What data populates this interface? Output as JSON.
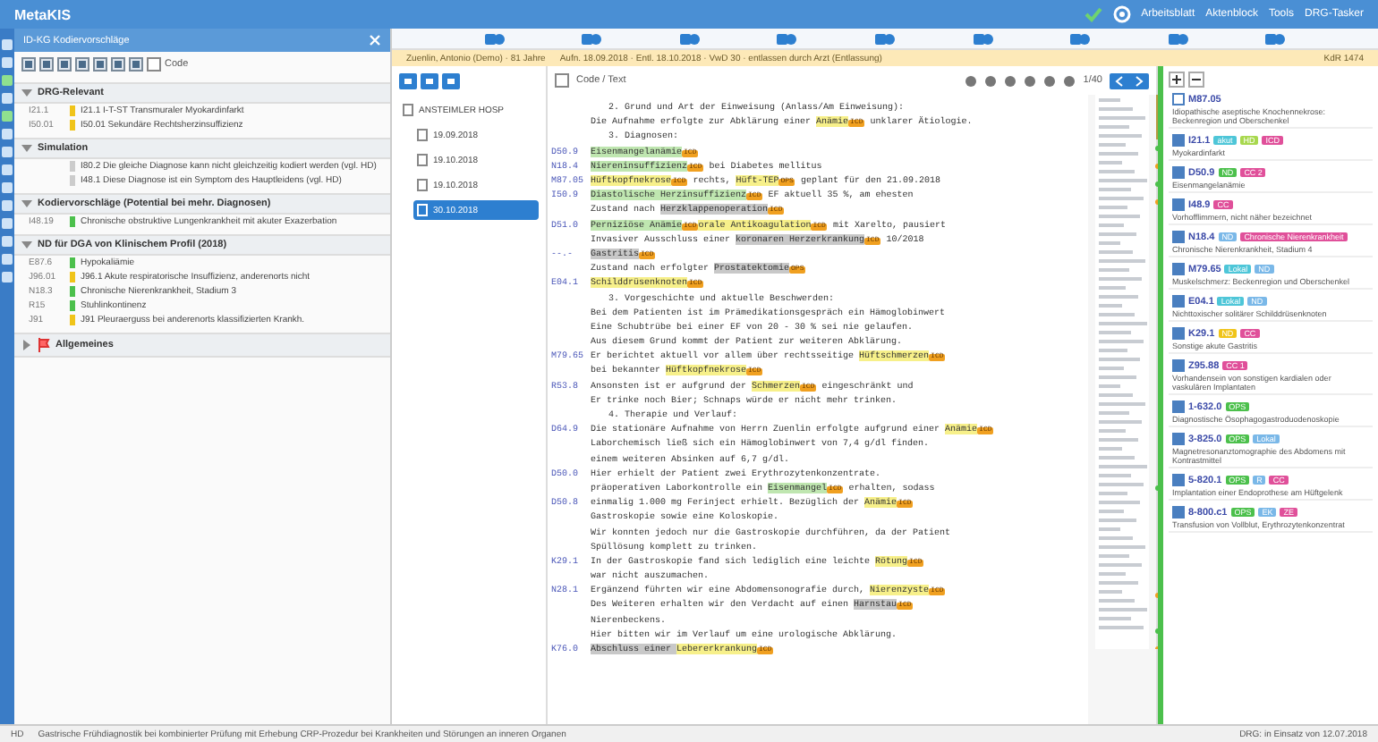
{
  "app": {
    "title": "MetaKIS",
    "menu": [
      "Arbeitsblatt",
      "Aktenblock",
      "Tools",
      "DRG-Tasker"
    ]
  },
  "left_panel": {
    "title": "ID-KG Kodiervorschläge",
    "filter": {
      "label": "Code",
      "checked": false
    },
    "groups": [
      {
        "title": "DRG-Relevant",
        "expanded": true,
        "items": [
          {
            "code": "I21.1",
            "text": "I21.1 I-T-ST Transmuraler Myokardinfarkt",
            "color": "#f0c419"
          },
          {
            "code": "I50.01",
            "text": "I50.01 Sekundäre Rechtsherzinsuffizienz",
            "color": "#f0c419"
          }
        ]
      },
      {
        "title": "Simulation",
        "expanded": true,
        "items": [
          {
            "text": "I80.2 Die gleiche Diagnose kann nicht gleichzeitig kodiert werden (vgl. HD)",
            "color": "#cccccc"
          },
          {
            "text": "I48.1 Diese Diagnose ist ein Symptom des Hauptleidens (vgl. HD)",
            "color": "#cccccc"
          }
        ]
      },
      {
        "title": "Kodiervorschläge (Potential bei mehr. Diagnosen)",
        "expanded": true,
        "items": [
          {
            "code": "I48.19",
            "text": "Chronische obstruktive Lungenkrankheit mit akuter Exazerbation",
            "color": "#4cc04c"
          }
        ]
      },
      {
        "title": "ND für DGA von Klinischem Profil (2018)",
        "expanded": true,
        "items": [
          {
            "code": "E87.6",
            "text": "Hypokaliämie",
            "color": "#4cc04c"
          },
          {
            "code": "J96.01",
            "text": "J96.1 Akute respiratorische Insuffizienz, anderenorts nicht",
            "color": "#f0c419"
          },
          {
            "code": "N18.3",
            "text": "Chronische Nierenkrankheit, Stadium 3",
            "color": "#4cc04c"
          },
          {
            "code": "R15",
            "text": "Stuhlinkontinenz",
            "color": "#4cc04c"
          },
          {
            "code": "J91",
            "text": "J91 Pleuraerguss bei anderenorts klassifizierten Krankh.",
            "color": "#f0c419"
          }
        ]
      },
      {
        "title": "Allgemeines",
        "expanded": false
      }
    ]
  },
  "patient_bar": {
    "patient": "Zuenlin, Antonio (Demo) · 81 Jahre",
    "case": "Aufn. 18.09.2018 · Entl. 18.10.2018 · VwD 30 · entlassen durch Arzt (Entlassung)",
    "right": "KdR 1474"
  },
  "tree": {
    "items": [
      {
        "label": "ANSTEIMLER HOSP",
        "selected": false,
        "children": [
          {
            "label": "19.09.2018",
            "selected": false
          },
          {
            "label": "19.10.2018",
            "selected": false
          },
          {
            "label": "19.10.2018",
            "selected": false
          },
          {
            "label": "30.10.2018",
            "selected": true
          }
        ]
      }
    ]
  },
  "editor": {
    "filter": {
      "label": "Code / Text",
      "checked": false
    },
    "page": "1/40",
    "lines": [
      {
        "kind": "section",
        "segments": [
          {
            "kind": "plain",
            "text": "2. Grund und Art der Einweisung (Anlass/Am Einweisung):"
          }
        ]
      },
      {
        "kind": "text",
        "segments": [
          {
            "kind": "plain",
            "text": "Die Aufnahme erfolgte zur Abklärung einer "
          },
          {
            "kind": "term",
            "text": "Anämie"
          },
          {
            "kind": "tag",
            "text": "ICD"
          },
          {
            "kind": "plain",
            "text": " unklarer Ätiologie."
          }
        ]
      },
      {
        "kind": "section",
        "segments": [
          {
            "kind": "plain",
            "text": "3. Diagnosen:"
          }
        ]
      },
      {
        "code": "D50.9",
        "kind": "text",
        "segments": [
          {
            "kind": "green",
            "text": "Eisenmangelanämie"
          },
          {
            "kind": "tag",
            "text": "ICD"
          }
        ]
      },
      {
        "code": "N18.4",
        "kind": "text",
        "segments": [
          {
            "kind": "green",
            "text": "Niereninsuffizienz"
          },
          {
            "kind": "tag",
            "text": "ICD"
          },
          {
            "kind": "plain",
            "text": " bei Diabetes mellitus"
          }
        ]
      },
      {
        "code": "M87.05",
        "kind": "text",
        "segments": [
          {
            "kind": "term",
            "text": "Hüftkopfnekrose"
          },
          {
            "kind": "tag",
            "text": "ICD"
          },
          {
            "kind": "plain",
            "text": " rechts, "
          },
          {
            "kind": "term",
            "text": "Hüft-TEP"
          },
          {
            "kind": "tag",
            "text": "OPS"
          },
          {
            "kind": "plain",
            "text": " geplant für den 21.09.2018"
          }
        ]
      },
      {
        "code": "I50.9",
        "kind": "text",
        "segments": [
          {
            "kind": "green",
            "text": "Diastolische Herzinsuffizienz"
          },
          {
            "kind": "tag",
            "text": "ICD"
          },
          {
            "kind": "plain",
            "text": " EF aktuell 35 %, am ehesten"
          }
        ]
      },
      {
        "kind": "text",
        "segments": [
          {
            "kind": "plain",
            "text": "Zustand nach "
          },
          {
            "kind": "grey",
            "text": "Herzklappenoperation"
          },
          {
            "kind": "tag",
            "text": "ICD"
          }
        ]
      },
      {
        "code": "D51.0",
        "kind": "text",
        "segments": [
          {
            "kind": "green",
            "text": "Perniziöse Anämie"
          },
          {
            "kind": "tag",
            "text": "ICD"
          },
          {
            "kind": "term",
            "text": "orale Antikoagulation"
          },
          {
            "kind": "tag",
            "text": "ICD"
          },
          {
            "kind": "plain",
            "text": " mit Xarelto, pausiert"
          }
        ]
      },
      {
        "kind": "text",
        "segments": [
          {
            "kind": "plain",
            "text": "Invasiver Ausschluss einer "
          },
          {
            "kind": "grey",
            "text": "koronaren Herzerkrankung"
          },
          {
            "kind": "tag",
            "text": "ICD"
          },
          {
            "kind": "plain",
            "text": " 10/2018"
          }
        ]
      },
      {
        "code": "--.-",
        "kind": "text",
        "segments": [
          {
            "kind": "grey",
            "text": "Gastritis"
          },
          {
            "kind": "tag",
            "text": "ICD"
          }
        ]
      },
      {
        "kind": "text",
        "segments": [
          {
            "kind": "plain",
            "text": "Zustand nach erfolgter "
          },
          {
            "kind": "grey",
            "text": "Prostatektomie"
          },
          {
            "kind": "tag",
            "text": "OPS"
          }
        ]
      },
      {
        "code": "E04.1",
        "kind": "text",
        "segments": [
          {
            "kind": "term",
            "text": "Schilddrüsenknoten"
          },
          {
            "kind": "tag",
            "text": "ICD"
          }
        ]
      },
      {
        "kind": "section",
        "segments": [
          {
            "kind": "plain",
            "text": "3. Vorgeschichte und aktuelle Beschwerden:"
          }
        ]
      },
      {
        "kind": "text",
        "segments": [
          {
            "kind": "plain",
            "text": "Bei dem Patienten ist im Prämedikationsgespräch ein Hämoglobinwert"
          }
        ]
      },
      {
        "kind": "text",
        "segments": [
          {
            "kind": "plain",
            "text": "Eine Schubtrübe bei einer EF von 20 - 30 % sei nie gelaufen."
          }
        ]
      },
      {
        "kind": "text",
        "segments": [
          {
            "kind": "plain",
            "text": "Aus diesem Grund kommt der Patient zur weiteren Abklärung."
          }
        ]
      },
      {
        "code": "M79.65",
        "kind": "text",
        "segments": [
          {
            "kind": "plain",
            "text": "Er berichtet aktuell vor allem über rechtsseitige "
          },
          {
            "kind": "term",
            "text": "Hüftschmerzen"
          },
          {
            "kind": "tag",
            "text": "ICD"
          }
        ]
      },
      {
        "kind": "text",
        "segments": [
          {
            "kind": "plain",
            "text": "bei bekannter "
          },
          {
            "kind": "term",
            "text": "Hüftkopfnekrose"
          },
          {
            "kind": "tag",
            "text": "ICD"
          }
        ]
      },
      {
        "code": "R53.8",
        "kind": "text",
        "segments": [
          {
            "kind": "plain",
            "text": "Ansonsten ist er aufgrund der "
          },
          {
            "kind": "term",
            "text": "Schmerzen"
          },
          {
            "kind": "tag",
            "text": "ICD"
          },
          {
            "kind": "plain",
            "text": " eingeschränkt und"
          }
        ]
      },
      {
        "kind": "text",
        "segments": [
          {
            "kind": "plain",
            "text": "Er trinke noch Bier; Schnaps würde er nicht mehr trinken."
          }
        ]
      },
      {
        "kind": "section",
        "segments": [
          {
            "kind": "plain",
            "text": "4. Therapie und Verlauf:"
          }
        ]
      },
      {
        "code": "D64.9",
        "kind": "text",
        "segments": [
          {
            "kind": "plain",
            "text": "Die stationäre Aufnahme von Herrn Zuenlin erfolgte aufgrund einer "
          },
          {
            "kind": "term",
            "text": "Anämie"
          },
          {
            "kind": "tag",
            "text": "ICD"
          }
        ]
      },
      {
        "kind": "text",
        "segments": [
          {
            "kind": "plain",
            "text": "Laborchemisch ließ sich ein Hämoglobinwert von 7,4 g/dl finden."
          }
        ]
      },
      {
        "kind": "text",
        "segments": [
          {
            "kind": "plain",
            "text": "einem weiteren Absinken auf 6,7 g/dl."
          }
        ]
      },
      {
        "code": "D50.0",
        "kind": "text",
        "segments": [
          {
            "kind": "plain",
            "text": "Hier erhielt der Patient zwei Erythrozytenkonzentrate."
          }
        ]
      },
      {
        "kind": "text",
        "segments": [
          {
            "kind": "plain",
            "text": "präoperativen Laborkontrolle ein "
          },
          {
            "kind": "green",
            "text": "Eisenmangel"
          },
          {
            "kind": "tag",
            "text": "ICD"
          },
          {
            "kind": "plain",
            "text": " erhalten, sodass"
          }
        ]
      },
      {
        "code": "D50.8",
        "kind": "text",
        "segments": [
          {
            "kind": "plain",
            "text": "einmalig 1.000 mg Ferinject erhielt. Bezüglich der "
          },
          {
            "kind": "term",
            "text": "Anämie"
          },
          {
            "kind": "tag",
            "text": "ICD"
          }
        ]
      },
      {
        "kind": "text",
        "segments": [
          {
            "kind": "plain",
            "text": "Gastroskopie sowie eine Koloskopie."
          }
        ]
      },
      {
        "kind": "text",
        "segments": [
          {
            "kind": "plain",
            "text": "Wir konnten jedoch nur die Gastroskopie durchführen, da der Patient"
          }
        ]
      },
      {
        "kind": "text",
        "segments": [
          {
            "kind": "plain",
            "text": "Spüllösung komplett zu trinken."
          }
        ]
      },
      {
        "code": "K29.1",
        "kind": "text",
        "segments": [
          {
            "kind": "plain",
            "text": "In der Gastroskopie fand sich lediglich eine leichte "
          },
          {
            "kind": "term",
            "text": "Rötung"
          },
          {
            "kind": "tag",
            "text": "ICD"
          }
        ]
      },
      {
        "kind": "text",
        "segments": [
          {
            "kind": "plain",
            "text": "war nicht auszumachen."
          }
        ]
      },
      {
        "code": "N28.1",
        "kind": "text",
        "segments": [
          {
            "kind": "plain",
            "text": "Ergänzend führten wir eine Abdomensonografie durch, "
          },
          {
            "kind": "term",
            "text": "Nierenzyste"
          },
          {
            "kind": "tag",
            "text": "ICD"
          }
        ]
      },
      {
        "kind": "text",
        "segments": [
          {
            "kind": "plain",
            "text": "Des Weiteren erhalten wir den Verdacht auf einen "
          },
          {
            "kind": "grey",
            "text": "Harnstau"
          },
          {
            "kind": "tag",
            "text": "ICD"
          }
        ]
      },
      {
        "kind": "text",
        "segments": [
          {
            "kind": "plain",
            "text": "Nierenbeckens."
          }
        ]
      },
      {
        "kind": "text",
        "segments": [
          {
            "kind": "plain",
            "text": "Hier bitten wir im Verlauf um eine urologische Abklärung."
          }
        ]
      },
      {
        "code": "K76.0",
        "kind": "text",
        "segments": [
          {
            "kind": "grey",
            "text": "Abschluss einer "
          },
          {
            "kind": "term",
            "text": "Lebererkrankung"
          },
          {
            "kind": "tag",
            "text": "ICD"
          }
        ]
      }
    ]
  },
  "codes": {
    "cards": [
      {
        "code": "M87.05",
        "selected": false,
        "text": "Idiopathische aseptische Knochennekrose: Beckenregion und Oberschenkel"
      },
      {
        "code": "I21.1",
        "selected": true,
        "tags": [
          {
            "text": "akut",
            "color": "#4ec6d8"
          },
          {
            "text": "HD",
            "color": "#a8d84e"
          },
          {
            "text": "ICD",
            "color": "#e0509a"
          }
        ],
        "text": "Myokardinfarkt"
      },
      {
        "code": "D50.9",
        "selected": true,
        "tags": [
          {
            "text": "ND",
            "color": "#4cc04c"
          },
          {
            "text": "CC 2",
            "color": "#e0509a"
          }
        ],
        "text": "Eisenmangelanämie"
      },
      {
        "code": "I48.9",
        "selected": true,
        "tags": [
          {
            "text": "CC",
            "color": "#e0509a"
          }
        ],
        "text": "Vorhofflimmern, nicht näher bezeichnet"
      },
      {
        "code": "N18.4",
        "selected": true,
        "tags": [
          {
            "text": "ND",
            "color": "#7ab8e8"
          },
          {
            "text": "Chronische Nierenkrankheit",
            "color": "#e0509a"
          }
        ],
        "text": "Chronische Nierenkrankheit, Stadium 4"
      },
      {
        "code": "M79.65",
        "selected": true,
        "tags": [
          {
            "text": "Lokal",
            "color": "#4ec6d8"
          },
          {
            "text": "ND",
            "color": "#7ab8e8"
          }
        ],
        "text": "Muskelschmerz: Beckenregion und Oberschenkel"
      },
      {
        "code": "E04.1",
        "selected": true,
        "tags": [
          {
            "text": "Lokal",
            "color": "#4ec6d8"
          },
          {
            "text": "ND",
            "color": "#7ab8e8"
          }
        ],
        "text": "Nichttoxischer solitärer Schilddrüsenknoten"
      },
      {
        "code": "K29.1",
        "selected": true,
        "tags": [
          {
            "text": "ND",
            "color": "#f0c419"
          },
          {
            "text": "CC",
            "color": "#e0509a"
          }
        ],
        "text": "Sonstige akute Gastritis"
      },
      {
        "code": "Z95.88",
        "selected": true,
        "tags": [
          {
            "text": "CC 1",
            "color": "#e0509a"
          }
        ],
        "text": "Vorhandensein von sonstigen kardialen oder vaskulären Implantaten"
      },
      {
        "code": "1-632.0",
        "selected": true,
        "tags": [
          {
            "text": "OPS",
            "color": "#4cc04c"
          }
        ],
        "text": "Diagnostische Ösophagogastroduodenoskopie"
      },
      {
        "code": "3-825.0",
        "selected": true,
        "tags": [
          {
            "text": "OPS",
            "color": "#4cc04c"
          },
          {
            "text": "Lokal",
            "color": "#7ab8e8"
          }
        ],
        "text": "Magnetresonanztomographie des Abdomens mit Kontrastmittel"
      },
      {
        "code": "5-820.1",
        "selected": true,
        "tags": [
          {
            "text": "OPS",
            "color": "#4cc04c"
          },
          {
            "text": "R",
            "color": "#7ab8e8"
          },
          {
            "text": "CC",
            "color": "#e0509a"
          }
        ],
        "text": "Implantation einer Endoprothese am Hüftgelenk"
      },
      {
        "code": "8-800.c1",
        "selected": true,
        "tags": [
          {
            "text": "OPS",
            "color": "#4cc04c"
          },
          {
            "text": "EK",
            "color": "#7ab8e8"
          },
          {
            "text": "ZE",
            "color": "#e0509a"
          }
        ],
        "text": "Transfusion von Vollblut, Erythrozytenkonzentrat"
      }
    ]
  },
  "status_bar": {
    "left": "HD",
    "text": "Gastrische Frühdiagnostik bei kombinierter Prüfung mit Erhebung CRP-Prozedur bei Krankheiten und Störungen an inneren Organen",
    "right": "DRG: in Einsatz von 12.07.2018"
  }
}
